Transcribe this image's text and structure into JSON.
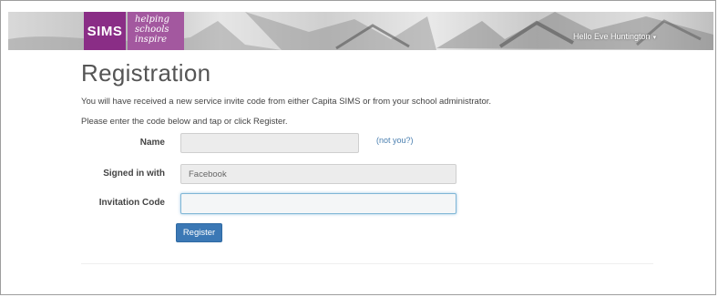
{
  "header": {
    "logo_text": "SIMS",
    "tagline": [
      "helping",
      "schools",
      "inspire"
    ],
    "greeting": "Hello Eve Huntington",
    "colors": {
      "logo": "#8a2d86",
      "tagline": "#a3589f"
    }
  },
  "page": {
    "title": "Registration",
    "intro": "You will have received a new service invite code from either Capita SIMS or from your school administrator.",
    "instruction": "Please enter the code below and tap or click Register."
  },
  "form": {
    "name_label": "Name",
    "name_value": "",
    "not_you_link": "(not you?)",
    "signed_in_label": "Signed in with",
    "signed_in_value": "Facebook",
    "code_label": "Invitation Code",
    "code_value": "",
    "register_button": "Register",
    "button_color": "#3b78b5"
  }
}
